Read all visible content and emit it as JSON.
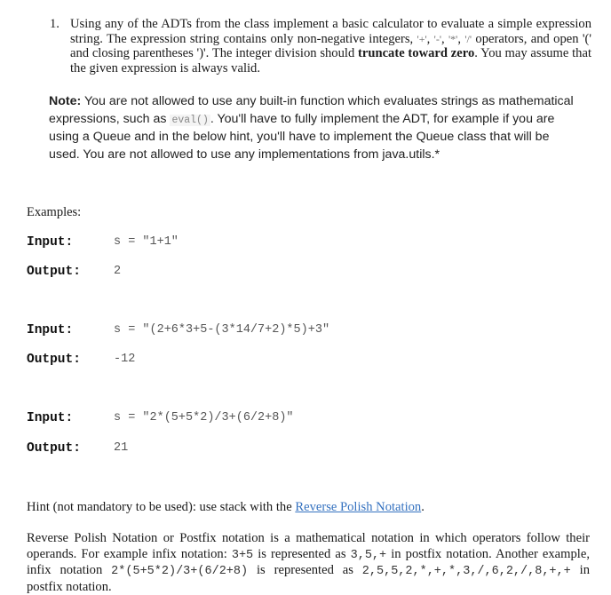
{
  "question": {
    "number": "1.",
    "text_part1": "Using any of the ADTs from the class implement a basic calculator to evaluate a simple expression string. The expression string contains only non-negative integers, ",
    "operators": [
      "'+'",
      "'-'",
      "'*'",
      "'/'"
    ],
    "text_part2": " operators, and open '(' and closing parentheses ')'. The integer division should ",
    "bold_phrase": "truncate toward zero",
    "text_part3": ". You may assume that the given expression is always valid."
  },
  "note": {
    "label": "Note:",
    "text_part1": " You are not allowed to use any built-in function which evaluates strings as mathematical expressions, such as ",
    "code": "eval()",
    "text_part2": ". You'll have to fully implement the ADT, for example if you are using a Queue and in the below hint, you'll have to implement the Queue class that will be used. You are not allowed to use any implementations from java.utils.*"
  },
  "examples": {
    "label": "Examples:",
    "items": [
      {
        "input_label": "Input:",
        "input_value": "s = \"1+1\"",
        "output_label": "Output:",
        "output_value": "2"
      },
      {
        "input_label": "Input:",
        "input_value": "s = \"(2+6*3+5-(3*14/7+2)*5)+3\"",
        "output_label": "Output:",
        "output_value": "-12"
      },
      {
        "input_label": "Input:",
        "input_value": "s = \"2*(5+5*2)/3+(6/2+8)\"",
        "output_label": "Output:",
        "output_value": "21"
      }
    ]
  },
  "hint": {
    "text": "Hint (not mandatory to be used): use stack with the ",
    "link_text": "Reverse Polish Notation",
    "suffix": "."
  },
  "rpn": {
    "t1": "Reverse Polish Notation or Postfix notation is a mathematical notation in which operators follow their operands. For example infix notation: ",
    "m1": "3+5",
    "t2": " is represented as ",
    "m2": "3,5,+",
    "t3": "  in postfix notation. Another example, infix notation ",
    "m3": "2*(5+5*2)/3+(6/2+8)",
    "t4": " is represented as ",
    "m4": "2,5,5,2,*,+,*,3,/,6,2,/,8,+,+",
    "t5": " in postfix notation."
  },
  "colors": {
    "link": "#3572c0",
    "code_text": "#888888",
    "mono_value": "#555555"
  }
}
